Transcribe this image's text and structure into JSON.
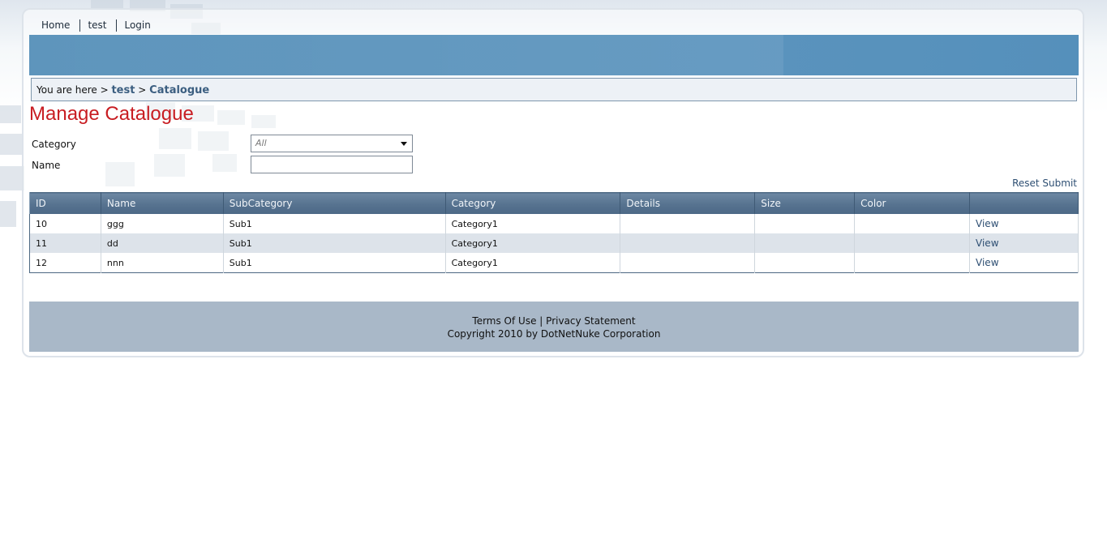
{
  "nav": {
    "items": [
      {
        "label": "Home"
      },
      {
        "label": "test"
      },
      {
        "label": "Login"
      }
    ]
  },
  "breadcrumb": {
    "prefix": "You are here >",
    "separator": ">",
    "items": [
      {
        "label": "test"
      },
      {
        "label": "Catalogue"
      }
    ]
  },
  "page": {
    "title": "Manage Catalogue"
  },
  "filters": {
    "category_label": "Category",
    "category_value": "All",
    "name_label": "Name",
    "name_value": ""
  },
  "actions": {
    "reset_label": "Reset",
    "submit_label": "Submit"
  },
  "table": {
    "columns": [
      "ID",
      "Name",
      "SubCategory",
      "Category",
      "Details",
      "Size",
      "Color",
      ""
    ],
    "rows": [
      {
        "id": "10",
        "name": "ggg",
        "subcategory": "Sub1",
        "category": "Category1",
        "details": "",
        "size": "",
        "color": "",
        "action": "View"
      },
      {
        "id": "11",
        "name": "dd",
        "subcategory": "Sub1",
        "category": "Category1",
        "details": "",
        "size": "",
        "color": "",
        "action": "View"
      },
      {
        "id": "12",
        "name": "nnn",
        "subcategory": "Sub1",
        "category": "Category1",
        "details": "",
        "size": "",
        "color": "",
        "action": "View"
      }
    ]
  },
  "footer": {
    "terms_label": "Terms Of Use",
    "divider": "|",
    "privacy_label": "Privacy Statement",
    "copyright": "Copyright 2010 by DotNetNuke Corporation"
  },
  "colors": {
    "banner": "#5a93bd",
    "title": "#c81d22",
    "link": "#2e4f73",
    "footer": "#a9b8c8"
  }
}
